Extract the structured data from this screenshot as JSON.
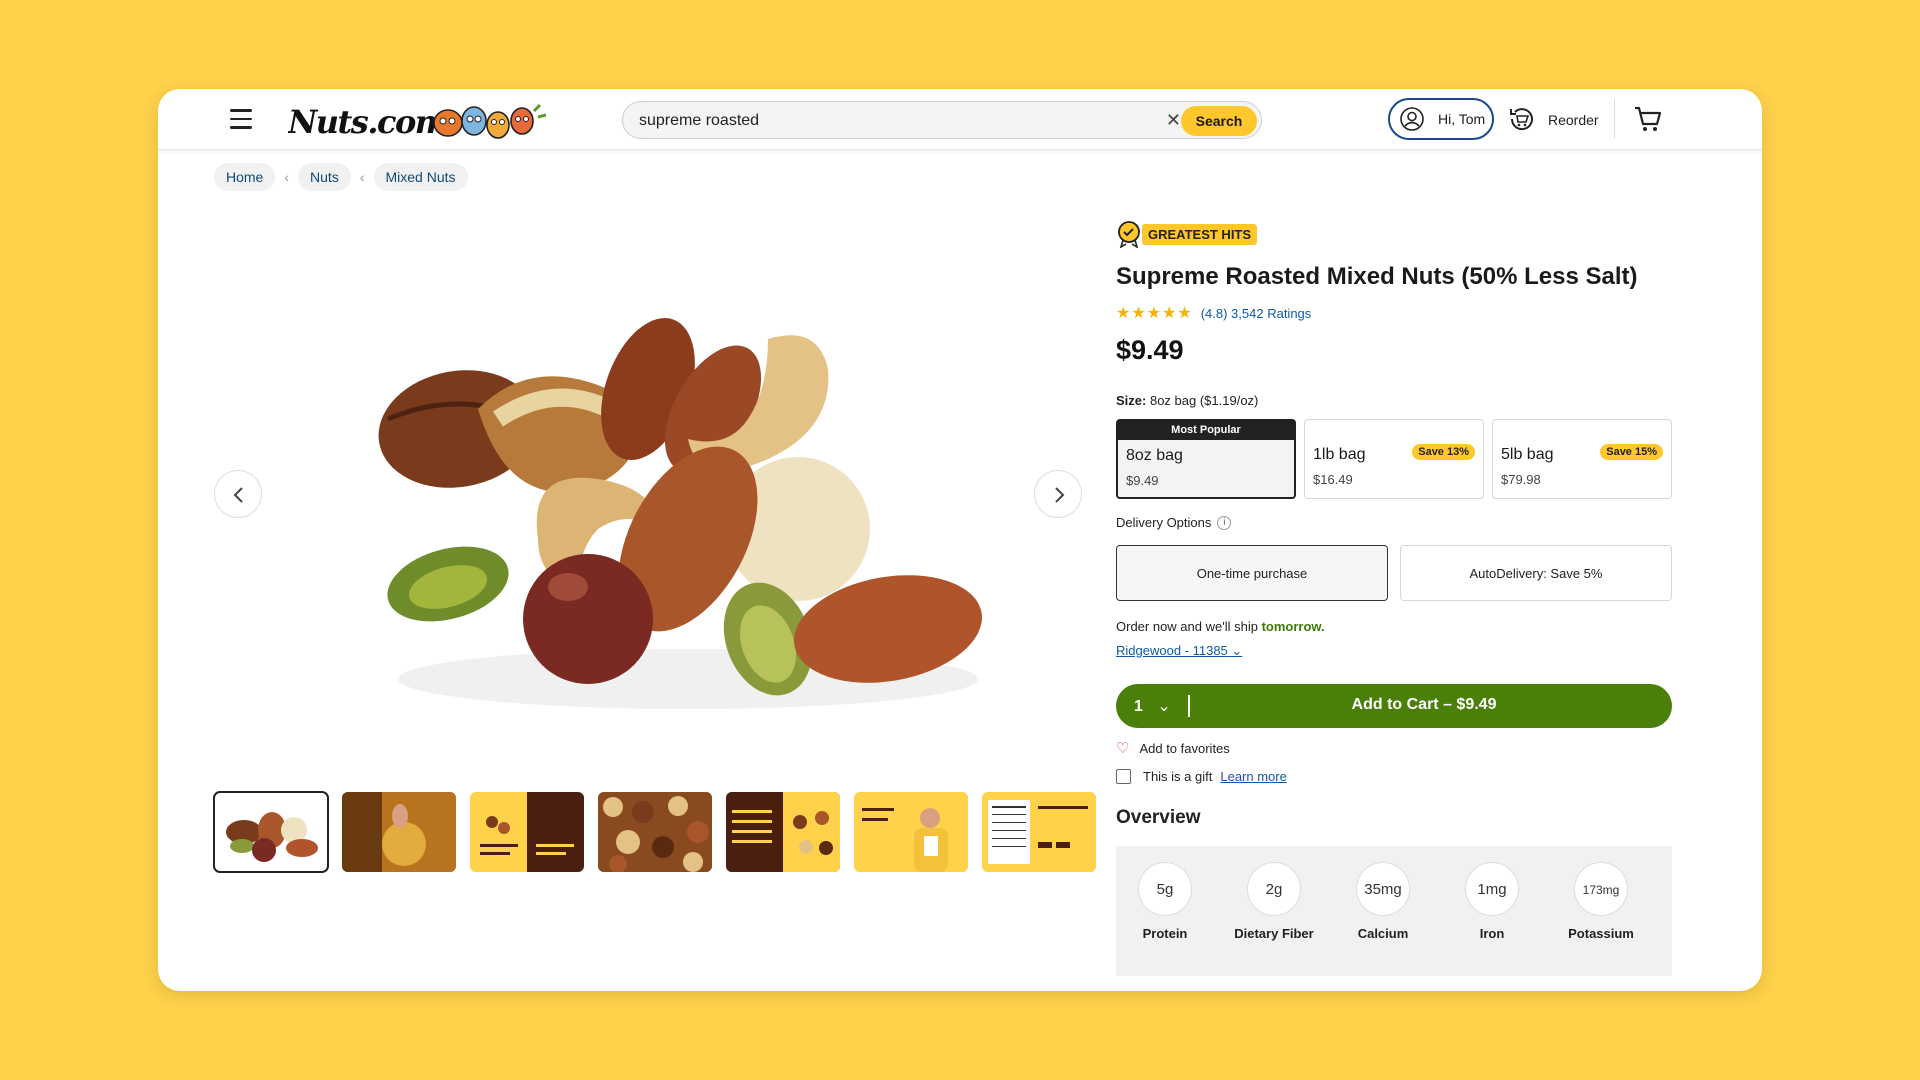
{
  "header": {
    "logo_text": "Nuts.com",
    "search": {
      "value": "supreme roasted",
      "button_label": "Search"
    },
    "account_label": "Hi, Tom",
    "reorder_label": "Reorder"
  },
  "breadcrumb": [
    "Home",
    "Nuts",
    "Mixed Nuts"
  ],
  "product": {
    "badge": "GREATEST HITS",
    "title": "Supreme Roasted Mixed Nuts (50% Less Salt)",
    "rating_text": "(4.8) 3,542 Ratings",
    "rating_value": 4.8,
    "price": "$9.49",
    "size_label_prefix": "Size:",
    "size_label_value": "8oz bag ($1.19/oz)",
    "sizes": [
      {
        "tag": "Most Popular",
        "name": "8oz bag",
        "price": "$9.49",
        "save": ""
      },
      {
        "tag": "",
        "name": "1lb bag",
        "price": "$16.49",
        "save": "Save 13%"
      },
      {
        "tag": "",
        "name": "5lb bag",
        "price": "$79.98",
        "save": "Save 15%"
      }
    ],
    "delivery_label": "Delivery Options",
    "delivery_options": [
      "One-time purchase",
      "AutoDelivery: Save 5%"
    ],
    "ship_text": "Order now and we'll ship",
    "ship_when": "tomorrow.",
    "location": "Ridgewood - 11385",
    "quantity": "1",
    "add_to_cart": "Add to Cart – $9.49",
    "favorites": "Add to favorites",
    "gift_text": "This is a gift",
    "learn_more": "Learn more",
    "overview_title": "Overview",
    "nutrition": [
      {
        "value": "5g",
        "label": "Protein"
      },
      {
        "value": "2g",
        "label": "Dietary Fiber"
      },
      {
        "value": "35mg",
        "label": "Calcium"
      },
      {
        "value": "1mg",
        "label": "Iron"
      },
      {
        "value": "173mg",
        "label": "Potassium"
      }
    ]
  },
  "icons": {
    "menu": "hamburger-icon",
    "clear": "close-icon",
    "account": "user-icon",
    "reorder": "reorder-icon",
    "cart": "cart-icon",
    "prev": "chevron-left-icon",
    "next": "chevron-right-icon",
    "chat": "chat-icon",
    "heart": "heart-icon"
  },
  "colors": {
    "background": "#FFD24A",
    "accent_yellow": "#FFC72C",
    "cart_green": "#4A7F0A",
    "link_blue": "#0d5ba8"
  }
}
